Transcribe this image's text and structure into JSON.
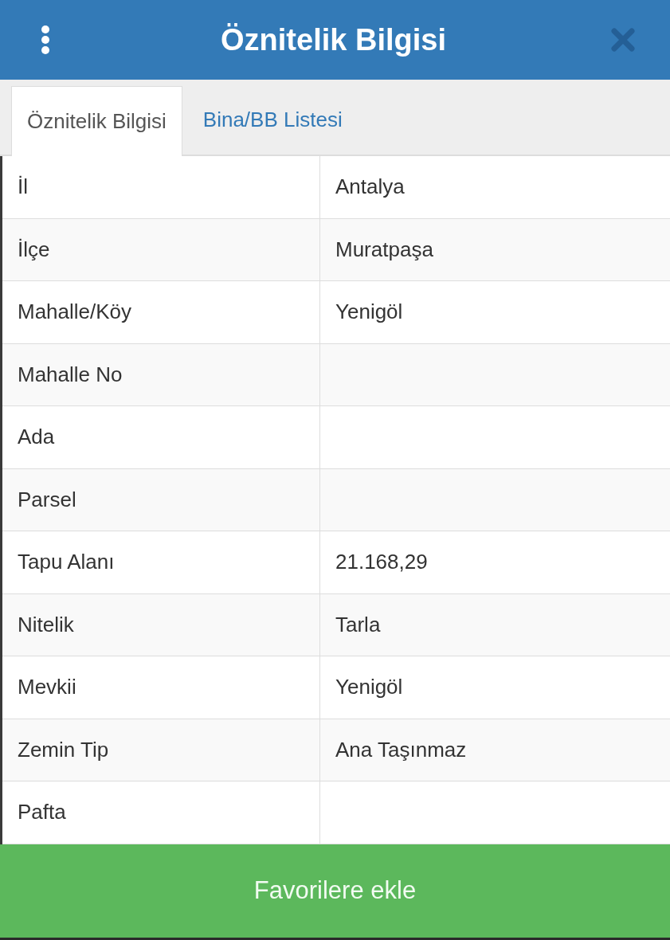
{
  "header": {
    "title": "Öznitelik Bilgisi"
  },
  "tabs": [
    {
      "label": "Öznitelik Bilgisi",
      "selected": true
    },
    {
      "label": "Bina/BB Listesi",
      "selected": false
    }
  ],
  "table": {
    "rows": [
      {
        "label": "İl",
        "value": "Antalya"
      },
      {
        "label": "İlçe",
        "value": "Muratpaşa"
      },
      {
        "label": "Mahalle/Köy",
        "value": "Yenigöl"
      },
      {
        "label": "Mahalle No"
      },
      {
        "label": "Ada"
      },
      {
        "label": "Parsel"
      },
      {
        "label": "Tapu Alanı",
        "value": "21.168,29"
      },
      {
        "label": "Nitelik",
        "value": "Tarla"
      },
      {
        "label": "Mevkii",
        "value": "Yenigöl"
      },
      {
        "label": "Zemin Tip",
        "value": "Ana Taşınmaz"
      },
      {
        "label": "Pafta"
      }
    ]
  },
  "footer_button": {
    "label": "Favorilere ekle"
  }
}
